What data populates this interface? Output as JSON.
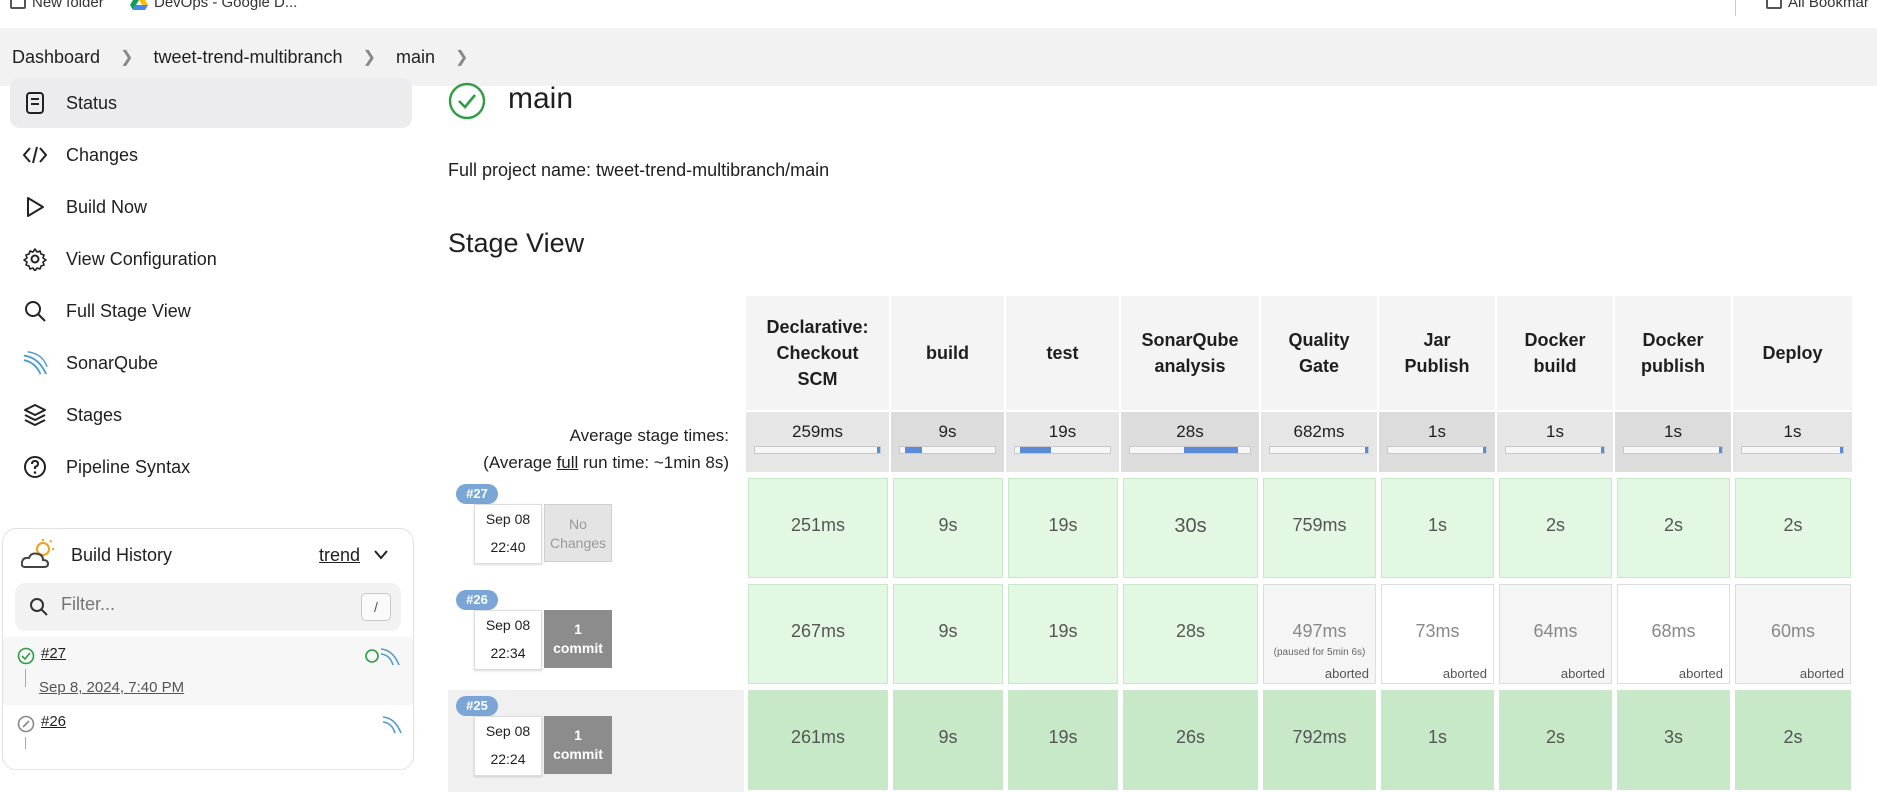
{
  "bookmarks": {
    "items": [
      {
        "label": "New folder",
        "icon": "folder-icon"
      },
      {
        "label": "DevOps - Google D...",
        "icon": "google-drive-icon"
      }
    ],
    "all_label": "All Bookmar"
  },
  "breadcrumb": [
    "Dashboard",
    "tweet-trend-multibranch",
    "main"
  ],
  "sidebar": {
    "items": [
      {
        "label": "Status",
        "icon": "document-icon"
      },
      {
        "label": "Changes",
        "icon": "code-icon"
      },
      {
        "label": "Build Now",
        "icon": "play-icon"
      },
      {
        "label": "View Configuration",
        "icon": "gear-icon"
      },
      {
        "label": "Full Stage View",
        "icon": "search-icon"
      },
      {
        "label": "SonarQube",
        "icon": "sonarqube-icon"
      },
      {
        "label": "Stages",
        "icon": "layers-icon"
      },
      {
        "label": "Pipeline Syntax",
        "icon": "help-icon"
      }
    ]
  },
  "build_history": {
    "title": "Build History",
    "trend": "trend",
    "filter_placeholder": "Filter...",
    "shortcut": "/",
    "builds": [
      {
        "number": "#27",
        "date": "Sep 8, 2024, 7:40 PM"
      },
      {
        "number": "#26",
        "date": ""
      }
    ]
  },
  "main": {
    "title": "main",
    "full_name": "Full project name: tweet-trend-multibranch/main",
    "stage_view_title": "Stage View"
  },
  "stage_view": {
    "stages": [
      "Declarative: Checkout SCM",
      "build",
      "test",
      "SonarQube analysis",
      "Quality Gate",
      "Jar Publish",
      "Docker build",
      "Docker publish",
      "Deploy"
    ],
    "avg_label_1": "Average stage times:",
    "avg_label_2_pre": "(Average ",
    "avg_label_2_link": "full",
    "avg_label_2_post": " run time: ~1min 8s)",
    "averages": [
      "259ms",
      "9s",
      "19s",
      "28s",
      "682ms",
      "1s",
      "1s",
      "1s",
      "1s"
    ],
    "avg_fill": [
      0.0,
      0.18,
      0.33,
      0.45,
      0.02,
      0.02,
      0.02,
      0.02,
      0.02
    ],
    "runs": [
      {
        "number": "#27",
        "date": "Sep 08",
        "time": "22:40",
        "changes_top": "No",
        "changes_bottom": "Changes",
        "has_commit": false,
        "cells": [
          {
            "value": "251ms",
            "status": "success"
          },
          {
            "value": "9s",
            "status": "success"
          },
          {
            "value": "19s",
            "status": "success"
          },
          {
            "value": "30s",
            "status": "success"
          },
          {
            "value": "759ms",
            "status": "success"
          },
          {
            "value": "1s",
            "status": "success"
          },
          {
            "value": "2s",
            "status": "success"
          },
          {
            "value": "2s",
            "status": "success"
          },
          {
            "value": "2s",
            "status": "success"
          }
        ]
      },
      {
        "number": "#26",
        "date": "Sep 08",
        "time": "22:34",
        "changes_top": "1",
        "changes_bottom": "commit",
        "has_commit": true,
        "cells": [
          {
            "value": "267ms",
            "status": "success"
          },
          {
            "value": "9s",
            "status": "success"
          },
          {
            "value": "19s",
            "status": "success"
          },
          {
            "value": "28s",
            "status": "success"
          },
          {
            "value": "497ms",
            "status": "aborted",
            "note": "(paused for 5min 6s)",
            "tag": "aborted"
          },
          {
            "value": "73ms",
            "status": "aborted-white",
            "tag": "aborted"
          },
          {
            "value": "64ms",
            "status": "aborted",
            "tag": "aborted"
          },
          {
            "value": "68ms",
            "status": "aborted-white",
            "tag": "aborted"
          },
          {
            "value": "60ms",
            "status": "aborted",
            "tag": "aborted"
          }
        ]
      },
      {
        "number": "#25",
        "date": "Sep 08",
        "time": "22:24",
        "changes_top": "1",
        "changes_bottom": "commit",
        "has_commit": true,
        "cells": [
          {
            "value": "261ms",
            "status": "success-dark"
          },
          {
            "value": "9s",
            "status": "success-dark"
          },
          {
            "value": "19s",
            "status": "success-dark"
          },
          {
            "value": "26s",
            "status": "success-dark"
          },
          {
            "value": "792ms",
            "status": "success-dark"
          },
          {
            "value": "1s",
            "status": "success-dark"
          },
          {
            "value": "2s",
            "status": "success-dark"
          },
          {
            "value": "3s",
            "status": "success-dark"
          },
          {
            "value": "2s",
            "status": "success-dark"
          }
        ]
      }
    ]
  },
  "colors": {
    "success": "#e2f8e2",
    "success_icon": "#2e9e44",
    "badge": "#7aa5d6",
    "bar": "#5b8bd6"
  }
}
